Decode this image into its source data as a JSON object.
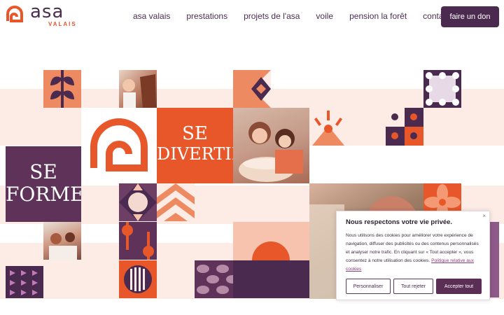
{
  "header": {
    "logo_text": "asa",
    "logo_sub": "VALAIS",
    "nav": [
      "asa valais",
      "prestations",
      "projets de l'asa",
      "voile",
      "pension la forêt",
      "contact"
    ],
    "donate_label": "faire un don"
  },
  "hero": {
    "tile_divertir_l1": "SE",
    "tile_divertir_l2": "DIVERTIR",
    "tile_former_l1": "SE",
    "tile_former_l2": "FORMER"
  },
  "cookie": {
    "close": "×",
    "title": "Nous respectons votre vie privée.",
    "text": "Nous utilisons des cookies pour améliorer votre expérience de navigation, diffuser des publicités ou des contenus personnalisés et analyser notre trafic. En cliquant sur « Tout accepter », vous consentez à notre utilisation des cookies.",
    "link": "Politique relative aux cookies",
    "btn_customize": "Personnaliser",
    "btn_reject": "Tout rejeter",
    "btn_accept": "Accepter tout"
  },
  "colors": {
    "purple": "#5a2e55",
    "orange": "#e8572a",
    "salmon": "#ee8a61",
    "pink": "#fdece6",
    "peach": "#f7c3ae"
  }
}
